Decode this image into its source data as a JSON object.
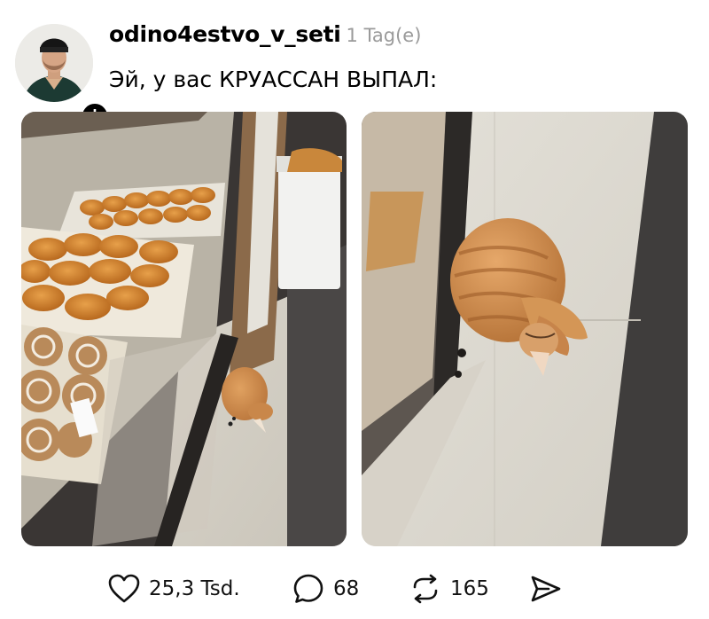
{
  "post": {
    "username": "odino4estvo_v_seti",
    "time": "1 Tag(e)",
    "caption": "Эй, у вас КРУАССАН ВЫПАЛ:",
    "avatar_badge": "+",
    "images": [
      {
        "icon": "photo",
        "depicts": "bakery display case with croissants and cat lying on floor"
      },
      {
        "icon": "photo",
        "depicts": "close-up of ginger cat curled on tile floor"
      }
    ]
  },
  "actions": {
    "likes": "25,3 Tsd.",
    "comments": "68",
    "reposts": "165",
    "icons": [
      "heart-icon",
      "comment-icon",
      "repost-icon",
      "share-icon"
    ]
  },
  "colors": {
    "text": "#000000",
    "muted": "#9a9a9a",
    "background": "#ffffff"
  }
}
